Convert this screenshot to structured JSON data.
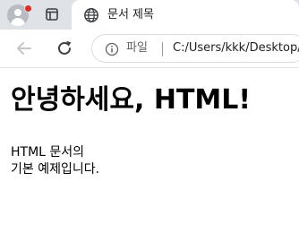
{
  "browser": {
    "tab": {
      "title": "문서 제목",
      "close_label": "×"
    },
    "omnibox": {
      "scheme_label": "파일",
      "url": "C:/Users/kkk/Desktop/"
    },
    "colors": {
      "profile_badge": "#d93025",
      "tabstrip": "#dfe3e8",
      "content": "#ffffff"
    },
    "icons": {
      "profile": "person-avatar-icon",
      "tab_actions": "window-tabs-icon",
      "favicon": "globe-icon",
      "back": "arrow-left-icon",
      "reload": "reload-icon",
      "info": "info-circle-icon"
    }
  },
  "page": {
    "heading": "안녕하세요, HTML!",
    "paragraph": {
      "line1": "HTML 문서의",
      "line2": "기본 예제입니다."
    }
  }
}
